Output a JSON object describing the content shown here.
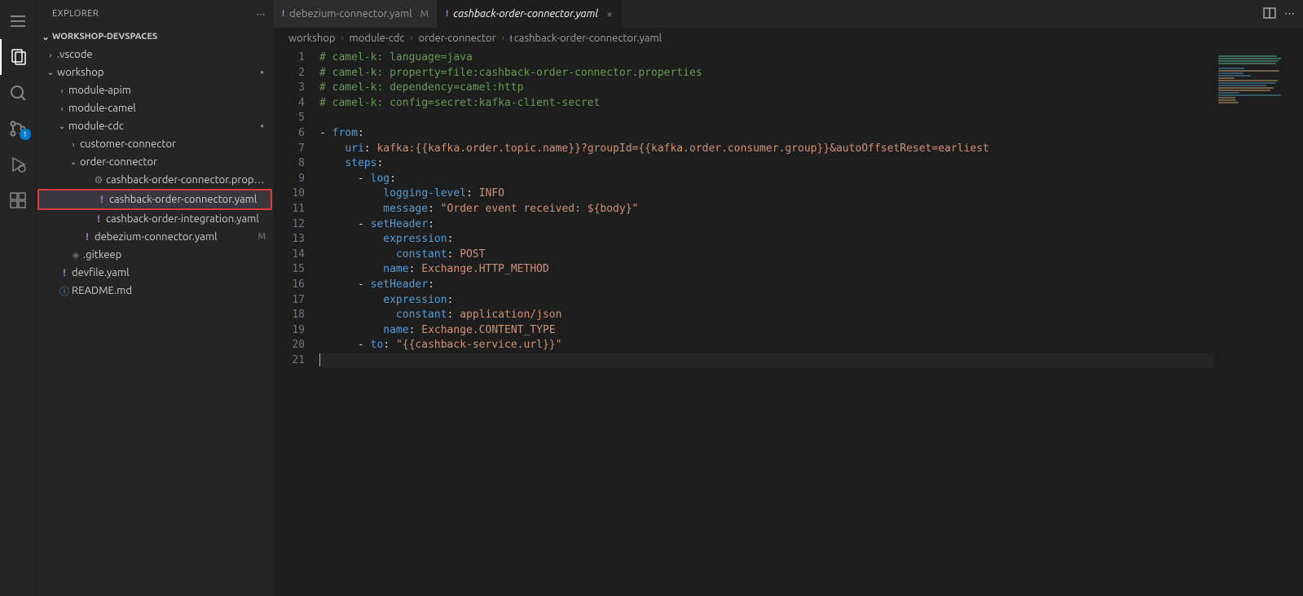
{
  "sidebar": {
    "title": "EXPLORER",
    "section": "WORKSHOP-DEVSPACES",
    "tree": [
      {
        "type": "folder",
        "name": ".vscode",
        "depth": 0,
        "open": false
      },
      {
        "type": "folder",
        "name": "workshop",
        "depth": 0,
        "open": true,
        "dot": true
      },
      {
        "type": "folder",
        "name": "module-apim",
        "depth": 1,
        "open": false
      },
      {
        "type": "folder",
        "name": "module-camel",
        "depth": 1,
        "open": false
      },
      {
        "type": "folder",
        "name": "module-cdc",
        "depth": 1,
        "open": true,
        "dot": true
      },
      {
        "type": "folder",
        "name": "customer-connector",
        "depth": 2,
        "open": false
      },
      {
        "type": "folder",
        "name": "order-connector",
        "depth": 2,
        "open": true
      },
      {
        "type": "file",
        "name": "cashback-order-connector.properties",
        "depth": 3,
        "icon": "gear"
      },
      {
        "type": "file",
        "name": "cashback-order-connector.yaml",
        "depth": 3,
        "icon": "yaml",
        "selected": true,
        "highlight": true
      },
      {
        "type": "file",
        "name": "cashback-order-integration.yaml",
        "depth": 3,
        "icon": "yaml"
      },
      {
        "type": "file",
        "name": "debezium-connector.yaml",
        "depth": 2,
        "icon": "yaml",
        "status": "M"
      },
      {
        "type": "file",
        "name": ".gitkeep",
        "depth": 1,
        "icon": "diamond"
      },
      {
        "type": "file",
        "name": "devfile.yaml",
        "depth": 0,
        "icon": "yaml"
      },
      {
        "type": "file",
        "name": "README.md",
        "depth": 0,
        "icon": "readme"
      }
    ]
  },
  "tabs": [
    {
      "label": "debezium-connector.yaml",
      "status": "M",
      "active": false
    },
    {
      "label": "cashback-order-connector.yaml",
      "status": "",
      "active": true,
      "italic": true,
      "closeable": true
    }
  ],
  "breadcrumb": [
    "workshop",
    "module-cdc",
    "order-connector",
    "cashback-order-connector.yaml"
  ],
  "scm_badge": "1",
  "editor": {
    "lines": [
      {
        "n": 1,
        "segs": [
          {
            "c": "c-comment",
            "t": "# camel-k: language=java"
          }
        ]
      },
      {
        "n": 2,
        "segs": [
          {
            "c": "c-comment",
            "t": "# camel-k: property=file:cashback-order-connector.properties"
          }
        ]
      },
      {
        "n": 3,
        "segs": [
          {
            "c": "c-comment",
            "t": "# camel-k: dependency=camel:http"
          }
        ]
      },
      {
        "n": 4,
        "segs": [
          {
            "c": "c-comment",
            "t": "# camel-k: config=secret:kafka-client-secret"
          }
        ]
      },
      {
        "n": 5,
        "segs": []
      },
      {
        "n": 6,
        "segs": [
          {
            "c": "c-dash",
            "t": "- "
          },
          {
            "c": "c-key",
            "t": "from"
          },
          {
            "c": "c-punc",
            "t": ":"
          }
        ]
      },
      {
        "n": 7,
        "segs": [
          {
            "c": "",
            "t": "    "
          },
          {
            "c": "c-key",
            "t": "uri"
          },
          {
            "c": "c-punc",
            "t": ": "
          },
          {
            "c": "c-val",
            "t": "kafka:{{kafka.order.topic.name}}?groupId={{kafka.order.consumer.group}}&autoOffsetReset=earliest"
          }
        ]
      },
      {
        "n": 8,
        "segs": [
          {
            "c": "",
            "t": "    "
          },
          {
            "c": "c-key",
            "t": "steps"
          },
          {
            "c": "c-punc",
            "t": ":"
          }
        ]
      },
      {
        "n": 9,
        "segs": [
          {
            "c": "",
            "t": "      "
          },
          {
            "c": "c-dash",
            "t": "- "
          },
          {
            "c": "c-key",
            "t": "log"
          },
          {
            "c": "c-punc",
            "t": ":"
          }
        ]
      },
      {
        "n": 10,
        "segs": [
          {
            "c": "",
            "t": "          "
          },
          {
            "c": "c-key",
            "t": "logging-level"
          },
          {
            "c": "c-punc",
            "t": ": "
          },
          {
            "c": "c-val",
            "t": "INFO"
          }
        ]
      },
      {
        "n": 11,
        "segs": [
          {
            "c": "",
            "t": "          "
          },
          {
            "c": "c-key",
            "t": "message"
          },
          {
            "c": "c-punc",
            "t": ": "
          },
          {
            "c": "c-string",
            "t": "\"Order event received: ${body}\""
          }
        ]
      },
      {
        "n": 12,
        "segs": [
          {
            "c": "",
            "t": "      "
          },
          {
            "c": "c-dash",
            "t": "- "
          },
          {
            "c": "c-key",
            "t": "setHeader"
          },
          {
            "c": "c-punc",
            "t": ":"
          }
        ]
      },
      {
        "n": 13,
        "segs": [
          {
            "c": "",
            "t": "          "
          },
          {
            "c": "c-key",
            "t": "expression"
          },
          {
            "c": "c-punc",
            "t": ":"
          }
        ]
      },
      {
        "n": 14,
        "segs": [
          {
            "c": "",
            "t": "            "
          },
          {
            "c": "c-key",
            "t": "constant"
          },
          {
            "c": "c-punc",
            "t": ": "
          },
          {
            "c": "c-val",
            "t": "POST"
          }
        ]
      },
      {
        "n": 15,
        "segs": [
          {
            "c": "",
            "t": "          "
          },
          {
            "c": "c-key",
            "t": "name"
          },
          {
            "c": "c-punc",
            "t": ": "
          },
          {
            "c": "c-val",
            "t": "Exchange.HTTP_METHOD"
          }
        ]
      },
      {
        "n": 16,
        "segs": [
          {
            "c": "",
            "t": "      "
          },
          {
            "c": "c-dash",
            "t": "- "
          },
          {
            "c": "c-key",
            "t": "setHeader"
          },
          {
            "c": "c-punc",
            "t": ":"
          }
        ]
      },
      {
        "n": 17,
        "segs": [
          {
            "c": "",
            "t": "          "
          },
          {
            "c": "c-key",
            "t": "expression"
          },
          {
            "c": "c-punc",
            "t": ":"
          }
        ]
      },
      {
        "n": 18,
        "segs": [
          {
            "c": "",
            "t": "            "
          },
          {
            "c": "c-key",
            "t": "constant"
          },
          {
            "c": "c-punc",
            "t": ": "
          },
          {
            "c": "c-val",
            "t": "application/json"
          }
        ]
      },
      {
        "n": 19,
        "segs": [
          {
            "c": "",
            "t": "          "
          },
          {
            "c": "c-key",
            "t": "name"
          },
          {
            "c": "c-punc",
            "t": ": "
          },
          {
            "c": "c-val",
            "t": "Exchange.CONTENT_TYPE"
          }
        ]
      },
      {
        "n": 20,
        "segs": [
          {
            "c": "",
            "t": "      "
          },
          {
            "c": "c-dash",
            "t": "- "
          },
          {
            "c": "c-key",
            "t": "to"
          },
          {
            "c": "c-punc",
            "t": ": "
          },
          {
            "c": "c-string",
            "t": "\"{{cashback-service.url}}\""
          }
        ]
      },
      {
        "n": 21,
        "segs": [],
        "cursor": true
      }
    ]
  }
}
